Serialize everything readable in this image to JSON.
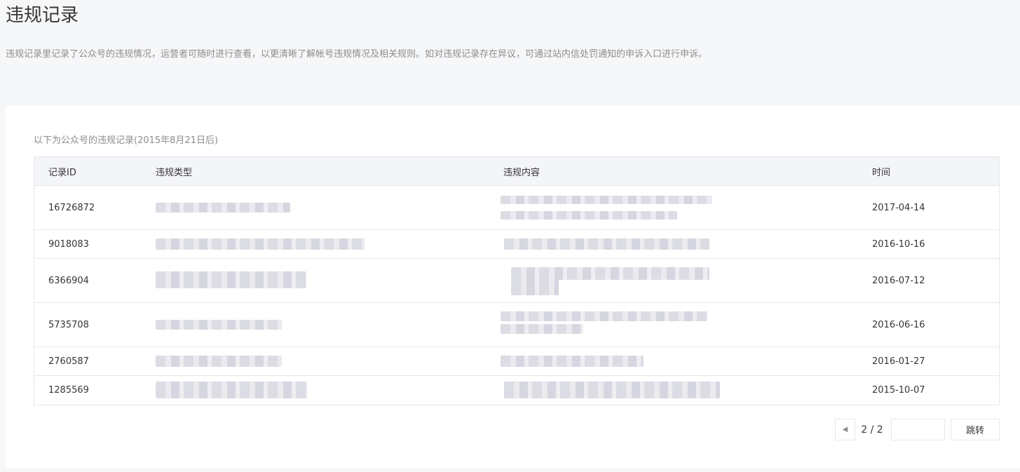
{
  "page": {
    "title": "违规记录",
    "description": "违规记录里记录了公众号的违规情况，运营者可随时进行查看，以更清晰了解帐号违规情况及相关规则。如对违规记录存在异议，可通过站内信处罚通知的申诉入口进行申诉。"
  },
  "records": {
    "subtitle": "以下为公众号的违规记录(2015年8月21日后)",
    "columns": [
      "记录ID",
      "违规类型",
      "违规内容",
      "时间"
    ],
    "rows": [
      {
        "id": "16726872",
        "type": "",
        "content": "",
        "time": "2017-04-14"
      },
      {
        "id": "9018083",
        "type": "",
        "content": "",
        "time": "2016-10-16"
      },
      {
        "id": "6366904",
        "type": "",
        "content": "",
        "time": "2016-07-12"
      },
      {
        "id": "5735708",
        "type": "",
        "content": "",
        "time": "2016-06-16"
      },
      {
        "id": "2760587",
        "type": "",
        "content": "",
        "time": "2016-01-27"
      },
      {
        "id": "1285569",
        "type": "",
        "content": "",
        "time": "2015-10-07"
      }
    ]
  },
  "pagination": {
    "prev_icon": "caret-left-icon",
    "page_indicator": "2 / 2",
    "jump_input_value": "",
    "jump_label": "跳转"
  }
}
